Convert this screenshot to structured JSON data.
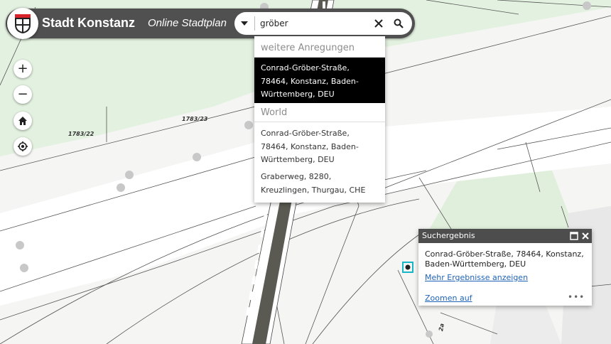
{
  "header": {
    "title": "Stadt Konstanz",
    "subtitle": "Online Stadtplan"
  },
  "search": {
    "value": "gröber",
    "scope_icon": "caret-down-icon",
    "clear_icon": "close-icon",
    "search_icon": "search-icon"
  },
  "suggestions": {
    "groups": [
      {
        "name": "weitere Anregungen",
        "items": [
          {
            "text": "Conrad-Gröber-Straße, 78464, Konstanz, Baden-Württemberg, DEU",
            "selected": true
          }
        ]
      },
      {
        "name": "World",
        "items": [
          {
            "text": "Conrad-Gröber-Straße, 78464, Konstanz, Baden-Württemberg, DEU",
            "selected": false
          },
          {
            "text": "Graberweg, 8280, Kreuzlingen, Thurgau, CHE",
            "selected": false
          }
        ]
      }
    ]
  },
  "map_controls": {
    "zoom_in": "+",
    "zoom_out": "−",
    "home_icon": "home-icon",
    "locate_icon": "locate-icon"
  },
  "parcel_labels": {
    "p1": "1783/23",
    "p2": "1783/22",
    "p3": "2a"
  },
  "popup": {
    "title": "Suchergebnis",
    "address": "Conrad-Gröber-Straße, 78464, Konstanz, Baden-Württemberg, DEU",
    "more_results": "Mehr Ergebnisse anzeigen",
    "zoom_to": "Zoomen auf",
    "menu": "•••"
  },
  "colors": {
    "header_bg": "#505050",
    "green_area": "#d7ecd4",
    "marker": "#16b6c8",
    "link": "#1e63b8"
  }
}
